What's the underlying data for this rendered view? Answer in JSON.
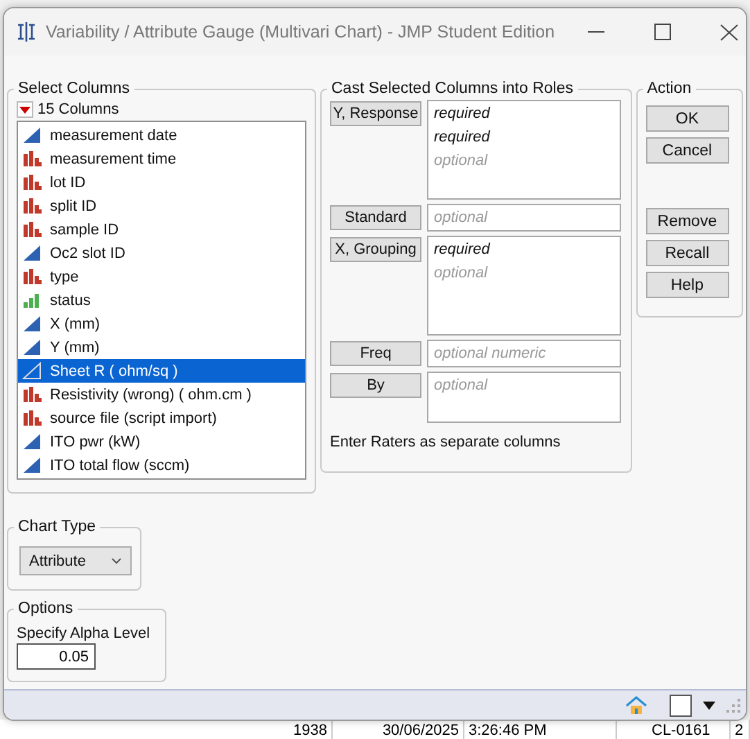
{
  "background_app": {
    "status_row": [
      "1938",
      "30/06/2025",
      "3:26:46 PM",
      "CL-0161",
      "2"
    ]
  },
  "window": {
    "title": "Variability / Attribute Gauge (Multivari Chart) - JMP Student Edition"
  },
  "select_columns": {
    "title": "Select Columns",
    "count": "15 Columns",
    "columns": [
      {
        "name": "measurement date",
        "kind": "continuous",
        "selected": false
      },
      {
        "name": "measurement time",
        "kind": "nominal",
        "selected": false
      },
      {
        "name": "lot ID",
        "kind": "nominal",
        "selected": false
      },
      {
        "name": "split ID",
        "kind": "nominal",
        "selected": false
      },
      {
        "name": "sample ID",
        "kind": "nominal",
        "selected": false
      },
      {
        "name": "Oc2 slot ID",
        "kind": "continuous",
        "selected": false
      },
      {
        "name": "type",
        "kind": "nominal",
        "selected": false
      },
      {
        "name": "status",
        "kind": "ordinal",
        "selected": false
      },
      {
        "name": "X (mm)",
        "kind": "continuous",
        "selected": false
      },
      {
        "name": "Y (mm)",
        "kind": "continuous",
        "selected": false
      },
      {
        "name": "Sheet R ( ohm/sq )",
        "kind": "continuous",
        "selected": true
      },
      {
        "name": "Resistivity (wrong) ( ohm.cm )",
        "kind": "nominal",
        "selected": false
      },
      {
        "name": "source file (script import)",
        "kind": "nominal",
        "selected": false
      },
      {
        "name": "ITO pwr (kW)",
        "kind": "continuous",
        "selected": false
      },
      {
        "name": "ITO total flow (sccm)",
        "kind": "continuous",
        "selected": false
      }
    ]
  },
  "roles": {
    "title": "Cast Selected Columns into Roles",
    "roles": [
      {
        "button": "Y, Response",
        "kind": "tall",
        "slots": [
          {
            "text": "required",
            "kind": "required"
          },
          {
            "text": "required",
            "kind": "required"
          },
          {
            "text": "optional",
            "kind": "optional"
          }
        ]
      },
      {
        "button": "Standard",
        "kind": "single",
        "slots": [
          {
            "text": "optional",
            "kind": "optional"
          }
        ]
      },
      {
        "button": "X, Grouping",
        "kind": "tall",
        "slots": [
          {
            "text": "required",
            "kind": "required"
          },
          {
            "text": "optional",
            "kind": "optional"
          }
        ]
      },
      {
        "button": "Freq",
        "kind": "single",
        "slots": [
          {
            "text": "optional numeric",
            "kind": "optional"
          }
        ]
      },
      {
        "button": "By",
        "kind": "short",
        "slots": [
          {
            "text": "optional",
            "kind": "optional"
          }
        ]
      }
    ],
    "note": "Enter Raters as separate columns"
  },
  "action": {
    "title": "Action",
    "primary": [
      "OK",
      "Cancel"
    ],
    "secondary": [
      "Remove",
      "Recall",
      "Help"
    ]
  },
  "chart_type": {
    "title": "Chart Type",
    "value": "Attribute"
  },
  "options": {
    "title": "Options",
    "label": "Specify Alpha Level",
    "value": "0.05"
  }
}
